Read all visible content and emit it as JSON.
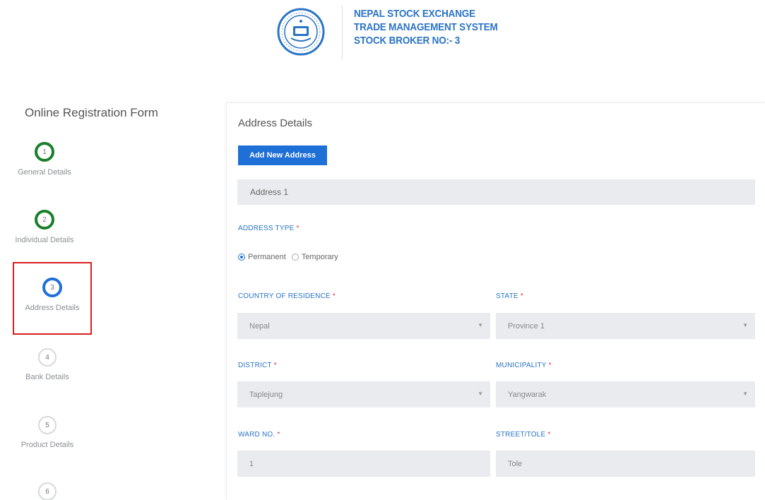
{
  "header": {
    "line1": "NEPAL STOCK EXCHANGE",
    "line2": "TRADE MANAGEMENT SYSTEM",
    "line3": "STOCK BROKER NO:- 3",
    "logo_icon": "nepse-seal-icon"
  },
  "sidebar": {
    "title": "Online Registration Form",
    "steps": [
      {
        "number": "1",
        "label": "General Details",
        "state": "done"
      },
      {
        "number": "2",
        "label": "Individual Details",
        "state": "done"
      },
      {
        "number": "3",
        "label": "Address Details",
        "state": "active"
      },
      {
        "number": "4",
        "label": "Bank Details",
        "state": "pending"
      },
      {
        "number": "5",
        "label": "Product Details",
        "state": "pending"
      },
      {
        "number": "6",
        "label": "",
        "state": "pending"
      }
    ]
  },
  "main": {
    "section_title": "Address Details",
    "add_button": "Add New Address",
    "address_item": "Address 1",
    "address_type": {
      "label": "ADDRESS TYPE",
      "required_mark": "*",
      "options": [
        "Permanent",
        "Temporary"
      ],
      "selected": "Permanent"
    },
    "fields": {
      "country": {
        "label": "COUNTRY OF RESIDENCE",
        "required_mark": "*",
        "value": "Nepal"
      },
      "state": {
        "label": "STATE",
        "required_mark": "*",
        "value": "Province 1"
      },
      "district": {
        "label": "DISTRICT",
        "required_mark": "*",
        "value": "Taplejung"
      },
      "municipality": {
        "label": "MUNICIPALITY",
        "required_mark": "*",
        "value": "Yangwarak"
      },
      "ward": {
        "label": "WARD NO.",
        "required_mark": "*",
        "value": "1"
      },
      "street": {
        "label": "STREET/TOLE",
        "required_mark": "*",
        "value": "Tole"
      }
    },
    "caret_glyph": "▼"
  },
  "colors": {
    "accent_blue": "#1e6fd6",
    "done_green": "#1a7f2a",
    "highlight_red": "#d9201f",
    "required_red": "#e0304a",
    "field_bg": "#e9ebee"
  }
}
